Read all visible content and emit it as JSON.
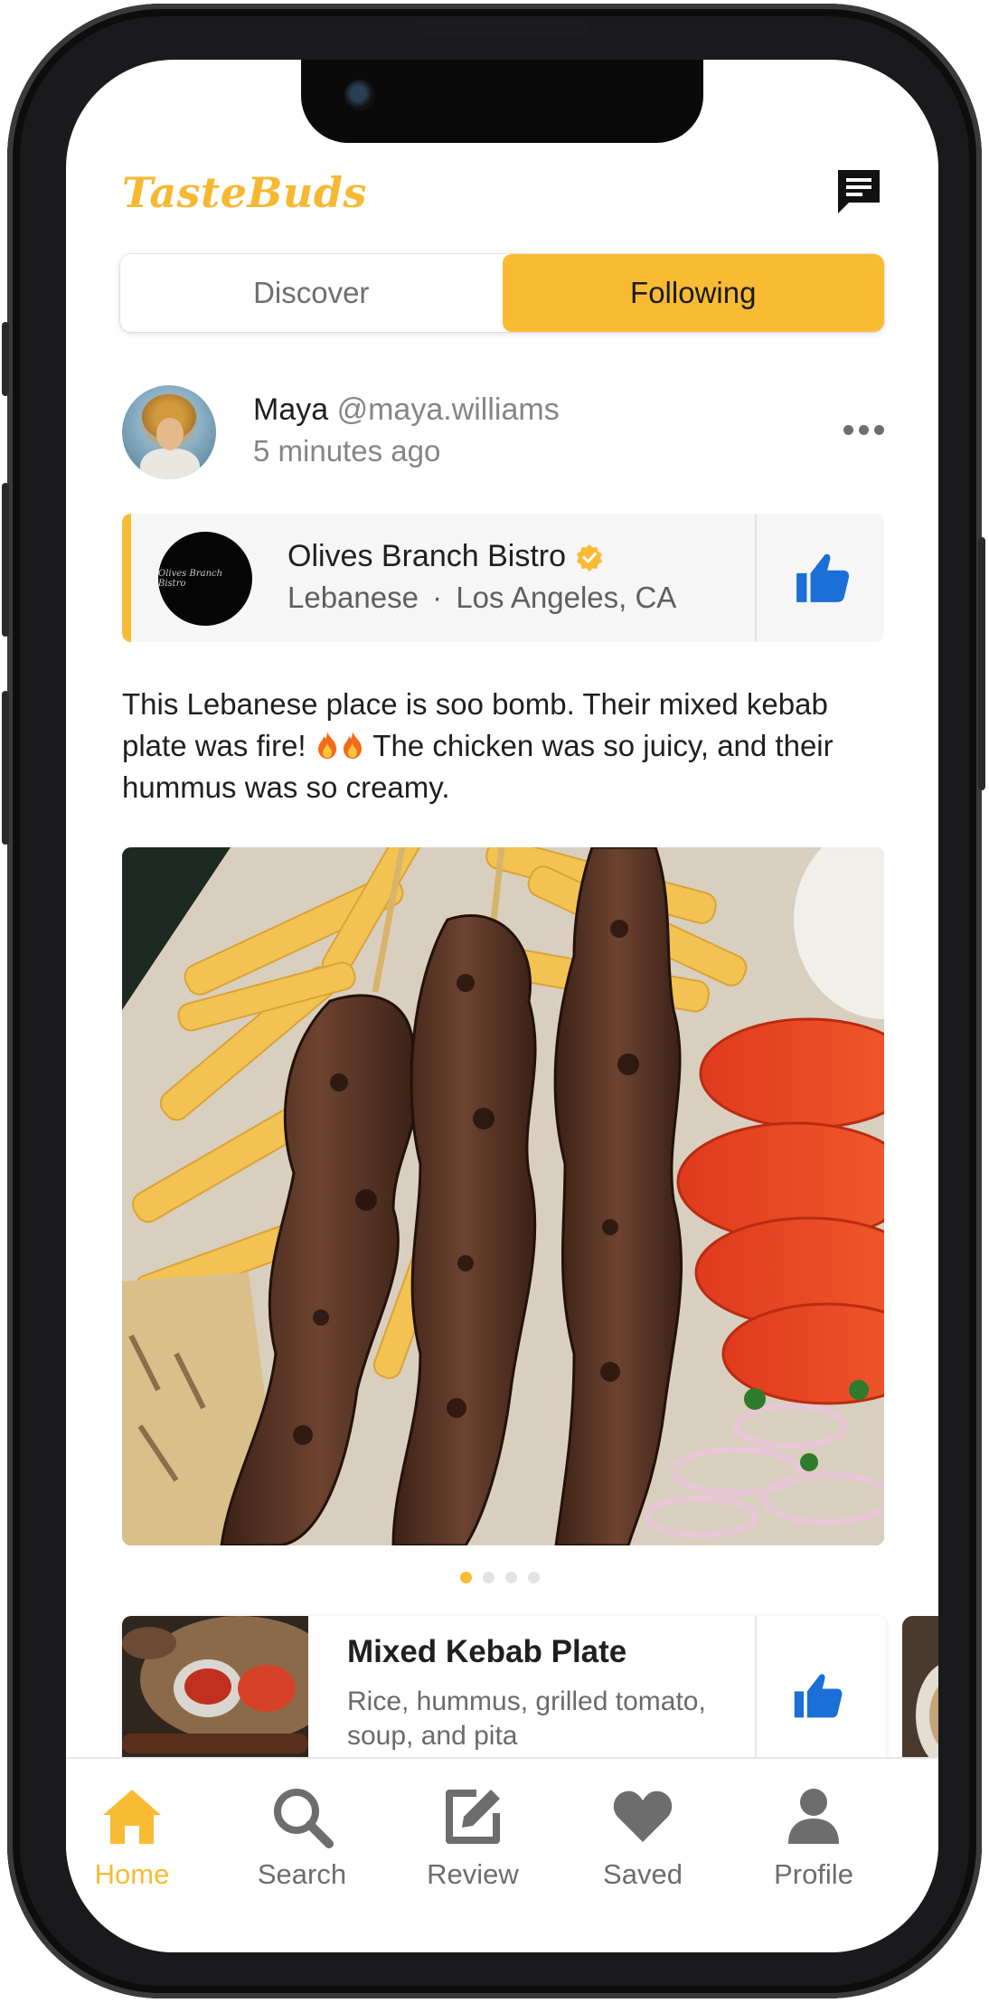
{
  "app": {
    "name": "TasteBuds"
  },
  "colors": {
    "accent": "#f9bb34",
    "like": "#1b6fd6",
    "text": "#1f1f1f",
    "muted": "#858585"
  },
  "header": {
    "logo": "TasteBuds",
    "chat_icon": "chat-icon"
  },
  "tabs": [
    {
      "label": "Discover",
      "active": false
    },
    {
      "label": "Following",
      "active": true
    }
  ],
  "post": {
    "author_name": "Maya",
    "author_handle": "@maya.williams",
    "time": "5 minutes ago",
    "restaurant": {
      "name": "Olives Branch Bistro",
      "verified": true,
      "cuisine": "Lebanese",
      "separator": "·",
      "location": "Los Angeles, CA",
      "logo_text": "Olives Branch Bistro"
    },
    "caption_1": "This Lebanese place is soo bomb. Their mixed kebab plate was fire! ",
    "caption_2": " The chicken was so juicy, and their hummus was so creamy.",
    "image_count": 4,
    "image_active": 1,
    "dish": {
      "name": "Mixed Kebab Plate",
      "description": "Rice, hummus, grilled tomato, soup, and pita"
    }
  },
  "nav": [
    {
      "label": "Home",
      "icon": "home-icon",
      "active": true
    },
    {
      "label": "Search",
      "icon": "search-icon",
      "active": false
    },
    {
      "label": "Review",
      "icon": "edit-icon",
      "active": false
    },
    {
      "label": "Saved",
      "icon": "heart-icon",
      "active": false
    },
    {
      "label": "Profile",
      "icon": "person-icon",
      "active": false
    }
  ]
}
